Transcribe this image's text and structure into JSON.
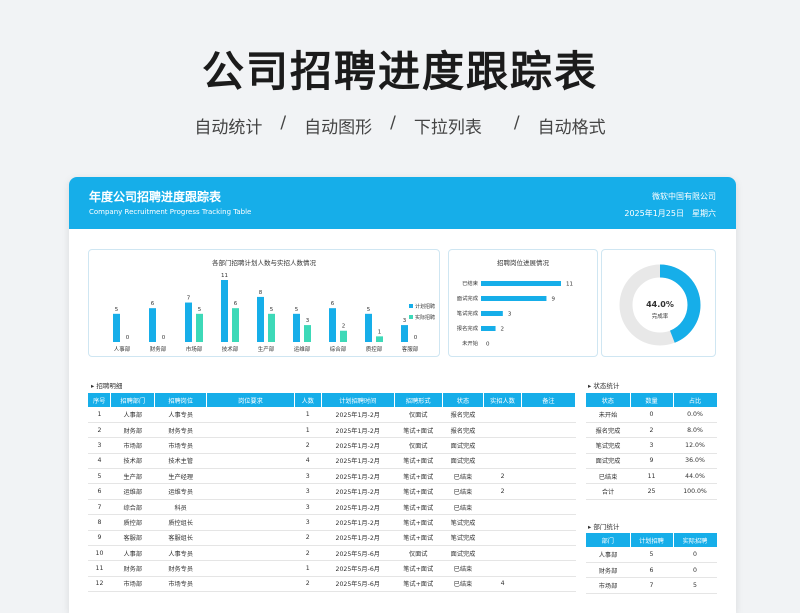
{
  "hero": {
    "title": "公司招聘进度跟踪表",
    "tags": [
      "自动统计",
      "自动图形",
      "下拉列表",
      "自动格式"
    ],
    "separator": "/"
  },
  "header": {
    "title_cn": "年度公司招聘进度跟踪表",
    "title_en": "Company Recruitment Progress Tracking Table",
    "company": "微软中国有限公司",
    "date": "2025年1月25日",
    "weekday": "星期六"
  },
  "colors": {
    "accent": "#16aee9",
    "plan": "#16aee9",
    "actual": "#3dd9b8",
    "ring_bg": "#e8e8e8"
  },
  "charts": {
    "dept_chart": {
      "type": "bar",
      "title": "各部门招聘计划人数与实招人数情况",
      "categories": [
        "人事部",
        "财务部",
        "市场部",
        "技术部",
        "生产部",
        "运维部",
        "综合部",
        "质控部",
        "客服部"
      ],
      "series": [
        {
          "name": "计划招聘",
          "values": [
            5,
            6,
            7,
            11,
            8,
            5,
            6,
            5,
            3
          ]
        },
        {
          "name": "实际招聘",
          "values": [
            0,
            0,
            5,
            6,
            5,
            3,
            2,
            1,
            0
          ]
        }
      ]
    },
    "status_chart": {
      "type": "bar",
      "title": "招聘岗位进展情况",
      "categories": [
        "已结束",
        "面试完成",
        "笔试完成",
        "报名完成",
        "未开始"
      ],
      "values": [
        11,
        9,
        3,
        2,
        0
      ]
    },
    "donut": {
      "value": "44.0%",
      "fraction": 0.44,
      "label": "完成率"
    }
  },
  "recruit_table": {
    "title": "招聘明细",
    "headers": [
      "序号",
      "招聘部门",
      "招聘岗位",
      "岗位要求",
      "人数",
      "计划招聘时间",
      "招聘形式",
      "状态",
      "实招人数",
      "备注"
    ],
    "rows": [
      [
        "1",
        "人事部",
        "人事专员",
        "",
        "1",
        "2025年1月-2月",
        "仅面试",
        "报名完成",
        "",
        ""
      ],
      [
        "2",
        "财务部",
        "财务专员",
        "",
        "1",
        "2025年1月-2月",
        "笔试+面试",
        "报名完成",
        "",
        ""
      ],
      [
        "3",
        "市场部",
        "市场专员",
        "",
        "2",
        "2025年1月-2月",
        "仅面试",
        "面试完成",
        "",
        ""
      ],
      [
        "4",
        "技术部",
        "技术主管",
        "",
        "4",
        "2025年1月-2月",
        "笔试+面试",
        "面试完成",
        "",
        ""
      ],
      [
        "5",
        "生产部",
        "生产经理",
        "",
        "3",
        "2025年1月-2月",
        "笔试+面试",
        "已结束",
        "2",
        ""
      ],
      [
        "6",
        "运维部",
        "运维专员",
        "",
        "3",
        "2025年1月-2月",
        "笔试+面试",
        "已结束",
        "2",
        ""
      ],
      [
        "7",
        "综合部",
        "科员",
        "",
        "3",
        "2025年1月-2月",
        "笔试+面试",
        "已结束",
        "",
        ""
      ],
      [
        "8",
        "质控部",
        "质控组长",
        "",
        "3",
        "2025年1月-2月",
        "笔试+面试",
        "笔试完成",
        "",
        ""
      ],
      [
        "9",
        "客服部",
        "客服组长",
        "",
        "2",
        "2025年1月-2月",
        "笔试+面试",
        "笔试完成",
        "",
        ""
      ],
      [
        "10",
        "人事部",
        "人事专员",
        "",
        "2",
        "2025年5月-6月",
        "仅面试",
        "面试完成",
        "",
        ""
      ],
      [
        "11",
        "财务部",
        "财务专员",
        "",
        "1",
        "2025年5月-6月",
        "笔试+面试",
        "已结束",
        "",
        ""
      ],
      [
        "12",
        "市场部",
        "市场专员",
        "",
        "2",
        "2025年5月-6月",
        "笔试+面试",
        "已结束",
        "4",
        ""
      ]
    ]
  },
  "status_stats": {
    "title": "状态统计",
    "headers": [
      "状态",
      "数量",
      "占比"
    ],
    "rows": [
      [
        "未开始",
        "0",
        "0.0%"
      ],
      [
        "报名完成",
        "2",
        "8.0%"
      ],
      [
        "笔试完成",
        "3",
        "12.0%"
      ],
      [
        "面试完成",
        "9",
        "36.0%"
      ],
      [
        "已结束",
        "11",
        "44.0%"
      ],
      [
        "合计",
        "25",
        "100.0%"
      ]
    ]
  },
  "dept_stats": {
    "title": "部门统计",
    "headers": [
      "部门",
      "计划招聘",
      "实际招聘"
    ],
    "rows": [
      [
        "人事部",
        "5",
        "0"
      ],
      [
        "财务部",
        "6",
        "0"
      ],
      [
        "市场部",
        "7",
        "5"
      ]
    ]
  }
}
